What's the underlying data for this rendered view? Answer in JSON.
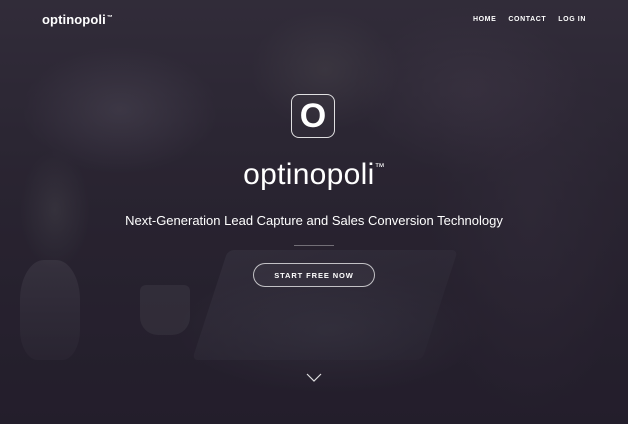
{
  "header": {
    "logo_text": "optinopoli",
    "logo_tm": "™"
  },
  "nav": {
    "items": [
      {
        "label": "HOME"
      },
      {
        "label": "CONTACT"
      },
      {
        "label": "LOG IN"
      }
    ]
  },
  "hero": {
    "mark_letter": "O",
    "brand_name": "optinopoli",
    "brand_tm": "™",
    "tagline": "Next-Generation Lead Capture and Sales Conversion Technology",
    "cta_label": "START FREE NOW"
  },
  "icons": {
    "scroll": "chevron-down-icon"
  },
  "colors": {
    "text": "#ffffff",
    "overlay": "#2b2533"
  }
}
